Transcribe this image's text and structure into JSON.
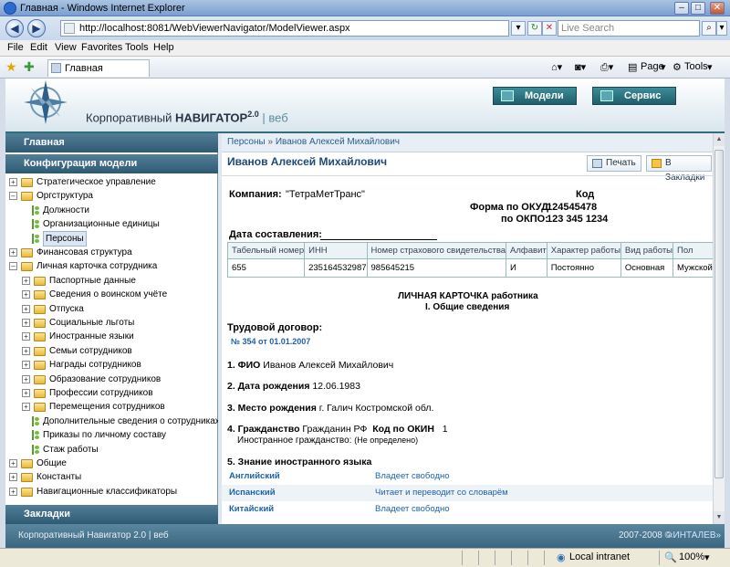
{
  "window": {
    "title": "Главная - Windows Internet Explorer",
    "minimize": "–",
    "maximize": "□",
    "close": "✕"
  },
  "browser": {
    "address": "http://localhost:8081/WebViewerNavigator/ModelViewer.aspx",
    "search_placeholder": "Live Search",
    "menu": [
      "File",
      "Edit",
      "View",
      "Favorites",
      "Tools",
      "Help"
    ],
    "tab_label": "Главная",
    "page_label": "Page",
    "tools_label": "Tools"
  },
  "app": {
    "title_prefix": "Корпоративный",
    "title_brand": "НАВИГАТОР",
    "version": "2.0",
    "title_suffix": "веб",
    "nav_buttons": [
      "Модели",
      "Сервис"
    ],
    "footer_left": "Корпоративный Навигатор 2.0 | веб",
    "footer_right_prefix": "2007-2008 ©",
    "footer_right_link": "«ИНТАЛЕВ»"
  },
  "sidebar": {
    "home": "Главная",
    "section": "Конфигурация модели",
    "bookmarks": "Закладки",
    "tree": [
      {
        "label": "Стратегическое управление",
        "level": 0,
        "type": "folder",
        "exp": "+"
      },
      {
        "label": "Оргструктура",
        "level": 0,
        "type": "folder",
        "exp": "–"
      },
      {
        "label": "Должности",
        "level": 1,
        "type": "leaf"
      },
      {
        "label": "Организационные единицы",
        "level": 1,
        "type": "leaf"
      },
      {
        "label": "Персоны",
        "level": 1,
        "type": "leaf",
        "selected": true
      },
      {
        "label": "Финансовая структура",
        "level": 0,
        "type": "folder",
        "exp": "+"
      },
      {
        "label": "Личная карточка сотрудника",
        "level": 0,
        "type": "folder",
        "exp": "–"
      },
      {
        "label": "Паспортные данные",
        "level": 1,
        "type": "folder",
        "exp": "+"
      },
      {
        "label": "Сведения о воинском учёте",
        "level": 1,
        "type": "folder",
        "exp": "+"
      },
      {
        "label": "Отпуска",
        "level": 1,
        "type": "folder",
        "exp": "+"
      },
      {
        "label": "Социальные льготы",
        "level": 1,
        "type": "folder",
        "exp": "+"
      },
      {
        "label": "Иностранные языки",
        "level": 1,
        "type": "folder",
        "exp": "+"
      },
      {
        "label": "Семьи сотрудников",
        "level": 1,
        "type": "folder",
        "exp": "+"
      },
      {
        "label": "Награды сотрудников",
        "level": 1,
        "type": "folder",
        "exp": "+"
      },
      {
        "label": "Образование сотрудников",
        "level": 1,
        "type": "folder",
        "exp": "+"
      },
      {
        "label": "Профессии сотрудников",
        "level": 1,
        "type": "folder",
        "exp": "+"
      },
      {
        "label": "Перемещения сотрудников",
        "level": 1,
        "type": "folder",
        "exp": "+"
      },
      {
        "label": "Дополнительные сведения о сотрудниках",
        "level": 1,
        "type": "leaf"
      },
      {
        "label": "Приказы по личному составу",
        "level": 1,
        "type": "leaf"
      },
      {
        "label": "Стаж работы",
        "level": 1,
        "type": "leaf"
      },
      {
        "label": "Общие",
        "level": 0,
        "type": "folder",
        "exp": "+"
      },
      {
        "label": "Константы",
        "level": 0,
        "type": "folder",
        "exp": "+"
      },
      {
        "label": "Навигационные классификаторы",
        "level": 0,
        "type": "folder",
        "exp": "+"
      }
    ]
  },
  "content": {
    "breadcrumb": [
      "Персоны",
      "Иванов Алексей Михайлович"
    ],
    "breadcrumb_sep": "»",
    "heading": "Иванов Алексей Михайлович",
    "print_button": "Печать",
    "bookmark_button": "В Закладки",
    "company_label": "Компания:",
    "company_value": "\"ТетраМетТранс\"",
    "code_label": "Код",
    "okud_label": "Форма по ОКУД:",
    "okud_value": "124545478",
    "okpo_label": "по ОКПО:",
    "okpo_value": "123 345 1234",
    "date_label": "Дата составления:",
    "table": {
      "headers": [
        "Табельный номер",
        "ИНН",
        "Номер страхового свидетельства",
        "Алфавит",
        "Характер работы",
        "Вид работы",
        "Пол"
      ],
      "row": [
        "655",
        "235164532987",
        "985645215",
        "И",
        "Постоянно",
        "Основная",
        "Мужской"
      ]
    },
    "card_title": "ЛИЧНАЯ КАРТОЧКА работника",
    "section_title": "I. Общие сведения",
    "contract_label": "Трудовой договор:",
    "contract_link": "№ 354 от 01.01.2007",
    "fio_label": "1. ФИО",
    "fio_value": "Иванов Алексей Михайлович",
    "birthdate_label": "2. Дата рождения",
    "birthdate_value": "12.06.1983",
    "birthplace_label": "3. Место рождения",
    "birthplace_value": "г. Галич Костромской обл.",
    "citizenship_label": "4. Гражданство",
    "citizenship_value": "Гражданин РФ",
    "okin_label": "Код по ОКИН",
    "okin_value": "1",
    "foreign_label": "Иностранное гражданство:",
    "foreign_value": "(Не определено)",
    "languages_label": "5. Знание иностранного языка",
    "languages": [
      {
        "name": "Английский",
        "level": "Владеет свободно"
      },
      {
        "name": "Испанский",
        "level": "Читает и переводит со словарём"
      },
      {
        "name": "Китайский",
        "level": "Владеет свободно"
      }
    ]
  },
  "status": {
    "zone": "Local intranet",
    "zoom": "100%"
  }
}
